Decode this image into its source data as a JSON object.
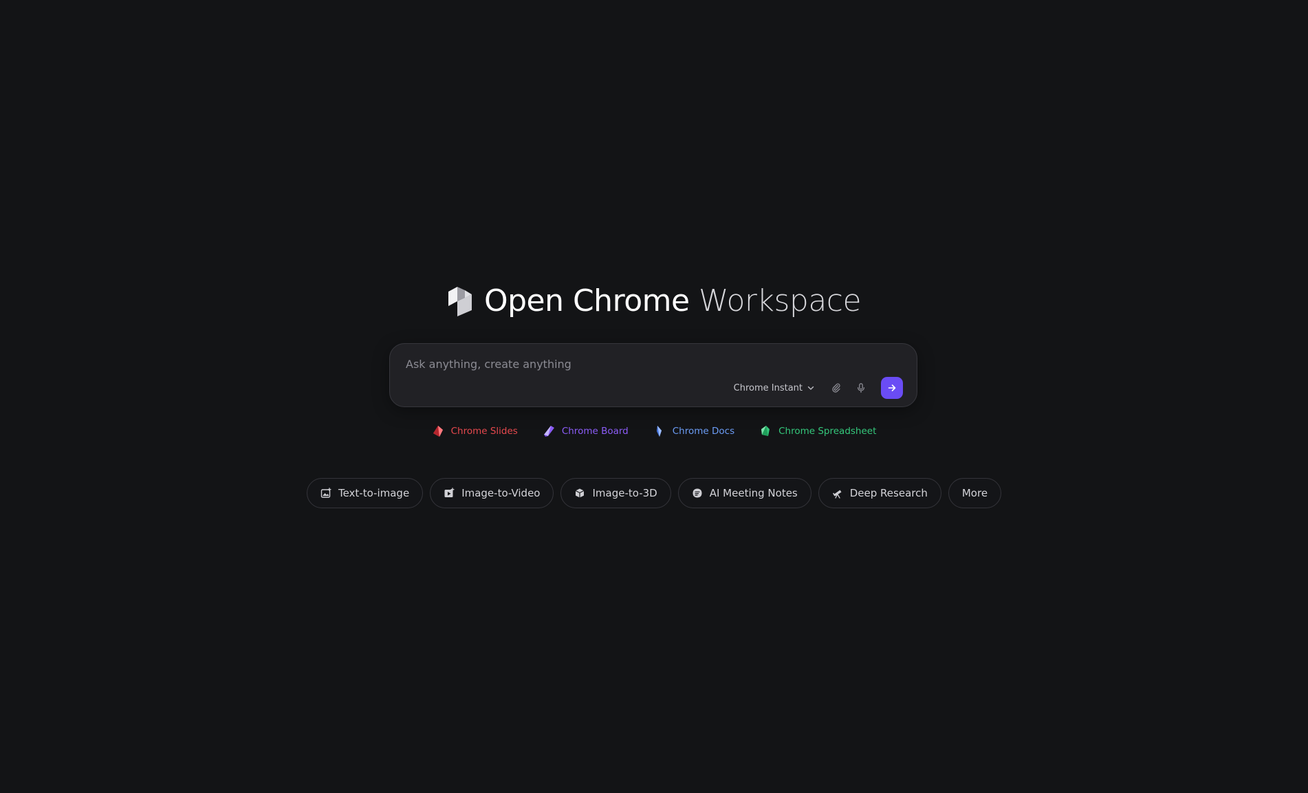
{
  "brand": {
    "title_strong": "Open Chrome",
    "title_light": "Workspace"
  },
  "prompt": {
    "placeholder": "Ask anything, create anything",
    "value": "",
    "model_label": "Chrome Instant"
  },
  "shortcuts": [
    {
      "label": "Chrome Slides",
      "color": "#e5484d"
    },
    {
      "label": "Chrome Board",
      "color": "#8b5cf6"
    },
    {
      "label": "Chrome Docs",
      "color": "#6b9cf5"
    },
    {
      "label": "Chrome Spreadsheet",
      "color": "#34c77b"
    }
  ],
  "chips": [
    {
      "label": "Text-to-image",
      "icon": "image-icon"
    },
    {
      "label": "Image-to-Video",
      "icon": "video-icon"
    },
    {
      "label": "Image-to-3D",
      "icon": "cube-icon"
    },
    {
      "label": "AI Meeting Notes",
      "icon": "notes-icon"
    },
    {
      "label": "Deep Research",
      "icon": "telescope-icon"
    },
    {
      "label": "More",
      "icon": ""
    }
  ],
  "colors": {
    "background": "#131416",
    "accent": "#6a4cf5",
    "input_bg": "#212125"
  }
}
